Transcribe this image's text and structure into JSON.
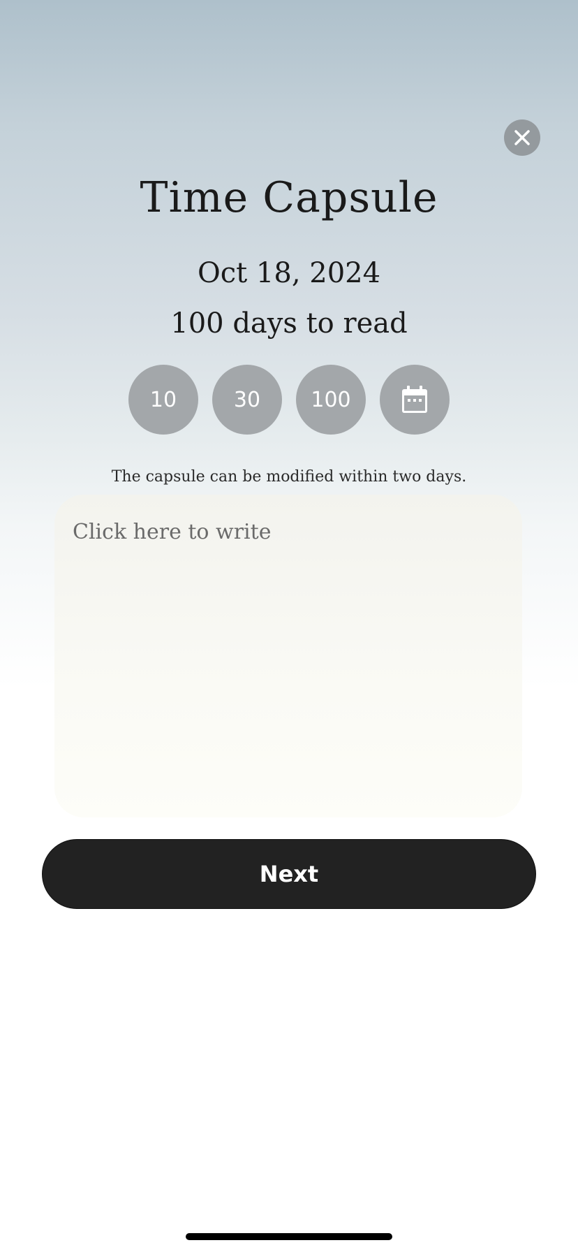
{
  "header": {
    "close_icon": "close-icon",
    "title": "Time Capsule"
  },
  "capsule": {
    "date": "Oct 18, 2024",
    "days_to_read": "100 days to read",
    "options": [
      {
        "label": "10"
      },
      {
        "label": "30"
      },
      {
        "label": "100"
      },
      {
        "icon": "calendar-icon"
      }
    ],
    "note": "The capsule can be modified within two days."
  },
  "editor": {
    "placeholder": "Click here to write"
  },
  "actions": {
    "next_label": "Next"
  },
  "colors": {
    "button_dark": "#222222",
    "option_circle": "#a3a7aa",
    "close_circle": "#949a9e"
  }
}
